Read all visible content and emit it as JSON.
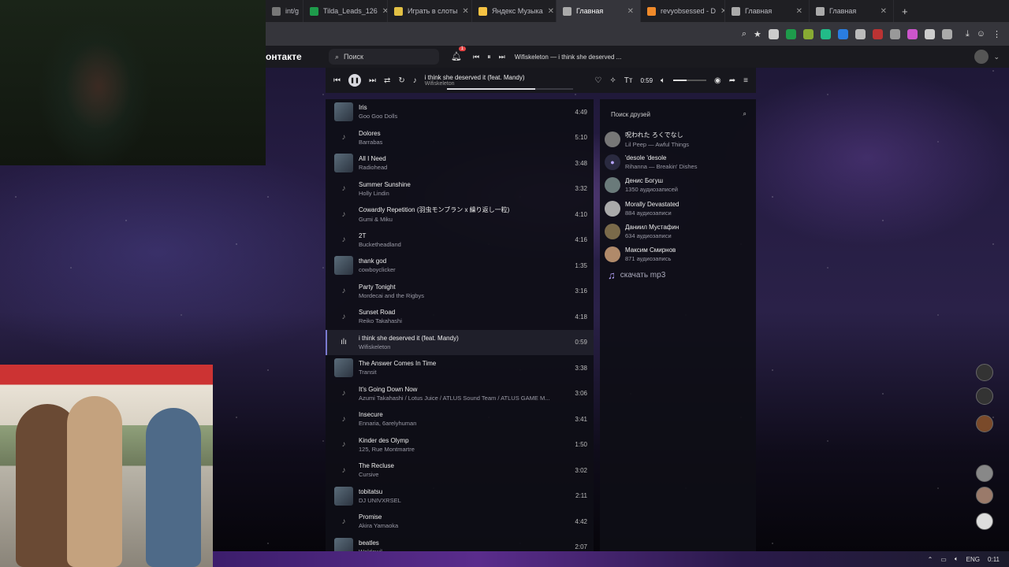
{
  "tabs": [
    {
      "label": "int/g",
      "color": "#777"
    },
    {
      "label": "Tilda_Leads_126",
      "color": "#1e9b4b"
    },
    {
      "label": "Играть в слоты",
      "color": "#e2c044"
    },
    {
      "label": "Яндекс Музыка",
      "color": "#f6c343"
    },
    {
      "label": "Главная",
      "color": "#aaa",
      "active": true
    },
    {
      "label": "revyobsessed - D",
      "color": "#f08a2a"
    },
    {
      "label": "Главная",
      "color": "#aaa"
    },
    {
      "label": "Главная",
      "color": "#aaa"
    }
  ],
  "vk": {
    "logo": "онтакте",
    "search_placeholder": "Поиск",
    "notif_count": "1",
    "now_playing": "Wifiskeleton — i think she deserved ..."
  },
  "player": {
    "title": "i think she deserved it (feat. Mandy)",
    "artist": "Wifiskeleton",
    "time": "0:59",
    "progress": 0.7,
    "volume": 0.4
  },
  "tracks": [
    {
      "title": "Iris",
      "artist": "Goo Goo Dolls",
      "dur": "4:49",
      "cover": true
    },
    {
      "title": "Dolores",
      "artist": "Barrabas",
      "dur": "5:10",
      "cover": false
    },
    {
      "title": "All I Need",
      "artist": "Radiohead",
      "dur": "3:48",
      "cover": true
    },
    {
      "title": "Summer Sunshine",
      "artist": "Holly Lindin",
      "dur": "3:32",
      "cover": false
    },
    {
      "title": "Cowardly Repetition (羽虫モンブラン x 繰り返し一粒)",
      "artist": "Gumi & Miku",
      "dur": "4:10",
      "cover": false
    },
    {
      "title": "2T",
      "artist": "Bucketheadland",
      "dur": "4:16",
      "cover": false
    },
    {
      "title": "thank god",
      "artist": "cowboyclicker",
      "dur": "1:35",
      "cover": true
    },
    {
      "title": "Party Tonight",
      "artist": "Mordecai and the Rigbys",
      "dur": "3:16",
      "cover": false
    },
    {
      "title": "Sunset Road",
      "artist": "Reiko Takahashi",
      "dur": "4:18",
      "cover": false
    },
    {
      "title": "i think she deserved it (feat. Mandy)",
      "artist": "Wifiskeleton",
      "dur": "0:59",
      "cover": false,
      "current": true
    },
    {
      "title": "The Answer Comes In Time",
      "artist": "Transit",
      "dur": "3:38",
      "cover": true
    },
    {
      "title": "It's Going Down Now",
      "artist": "Azumi Takahashi / Lotus Juice / ATLUS Sound Team / ATLUS GAME M...",
      "dur": "3:06",
      "cover": false
    },
    {
      "title": "Insecure",
      "artist": "Ennaria, 6arelyhuman",
      "dur": "3:41",
      "cover": false
    },
    {
      "title": "Kinder des Olymp",
      "artist": "125, Rue Montmartre",
      "dur": "1:50",
      "cover": false
    },
    {
      "title": "The Recluse",
      "artist": "Cursive",
      "dur": "3:02",
      "cover": false
    },
    {
      "title": "tobitatsu",
      "artist": "DJ UNIVXRSEL",
      "dur": "2:11",
      "cover": true
    },
    {
      "title": "Promise",
      "artist": "Akira Yamaoka",
      "dur": "4:42",
      "cover": false
    },
    {
      "title": "beatles",
      "artist": "Woldewil",
      "dur": "2:07",
      "cover": true
    }
  ],
  "friends_search": "Поиск друзей",
  "friends": [
    {
      "name": "呪われた ろくでなし",
      "sub": "Lil Peep — Awful Things"
    },
    {
      "name": "'desole 'desole",
      "sub": "Rihanna — Breakin' Dishes"
    },
    {
      "name": "Денис Богуш",
      "sub": "1350 аудиозаписей"
    },
    {
      "name": "Morally Devastated",
      "sub": "884 аудиозаписи"
    },
    {
      "name": "Даниил Мустафин",
      "sub": "634 аудиозаписи"
    },
    {
      "name": "Максим Смирнов",
      "sub": "871 аудиозапись"
    }
  ],
  "download_label": "скачать mp3",
  "taskbar": {
    "lang": "ENG",
    "time": "0:11"
  }
}
